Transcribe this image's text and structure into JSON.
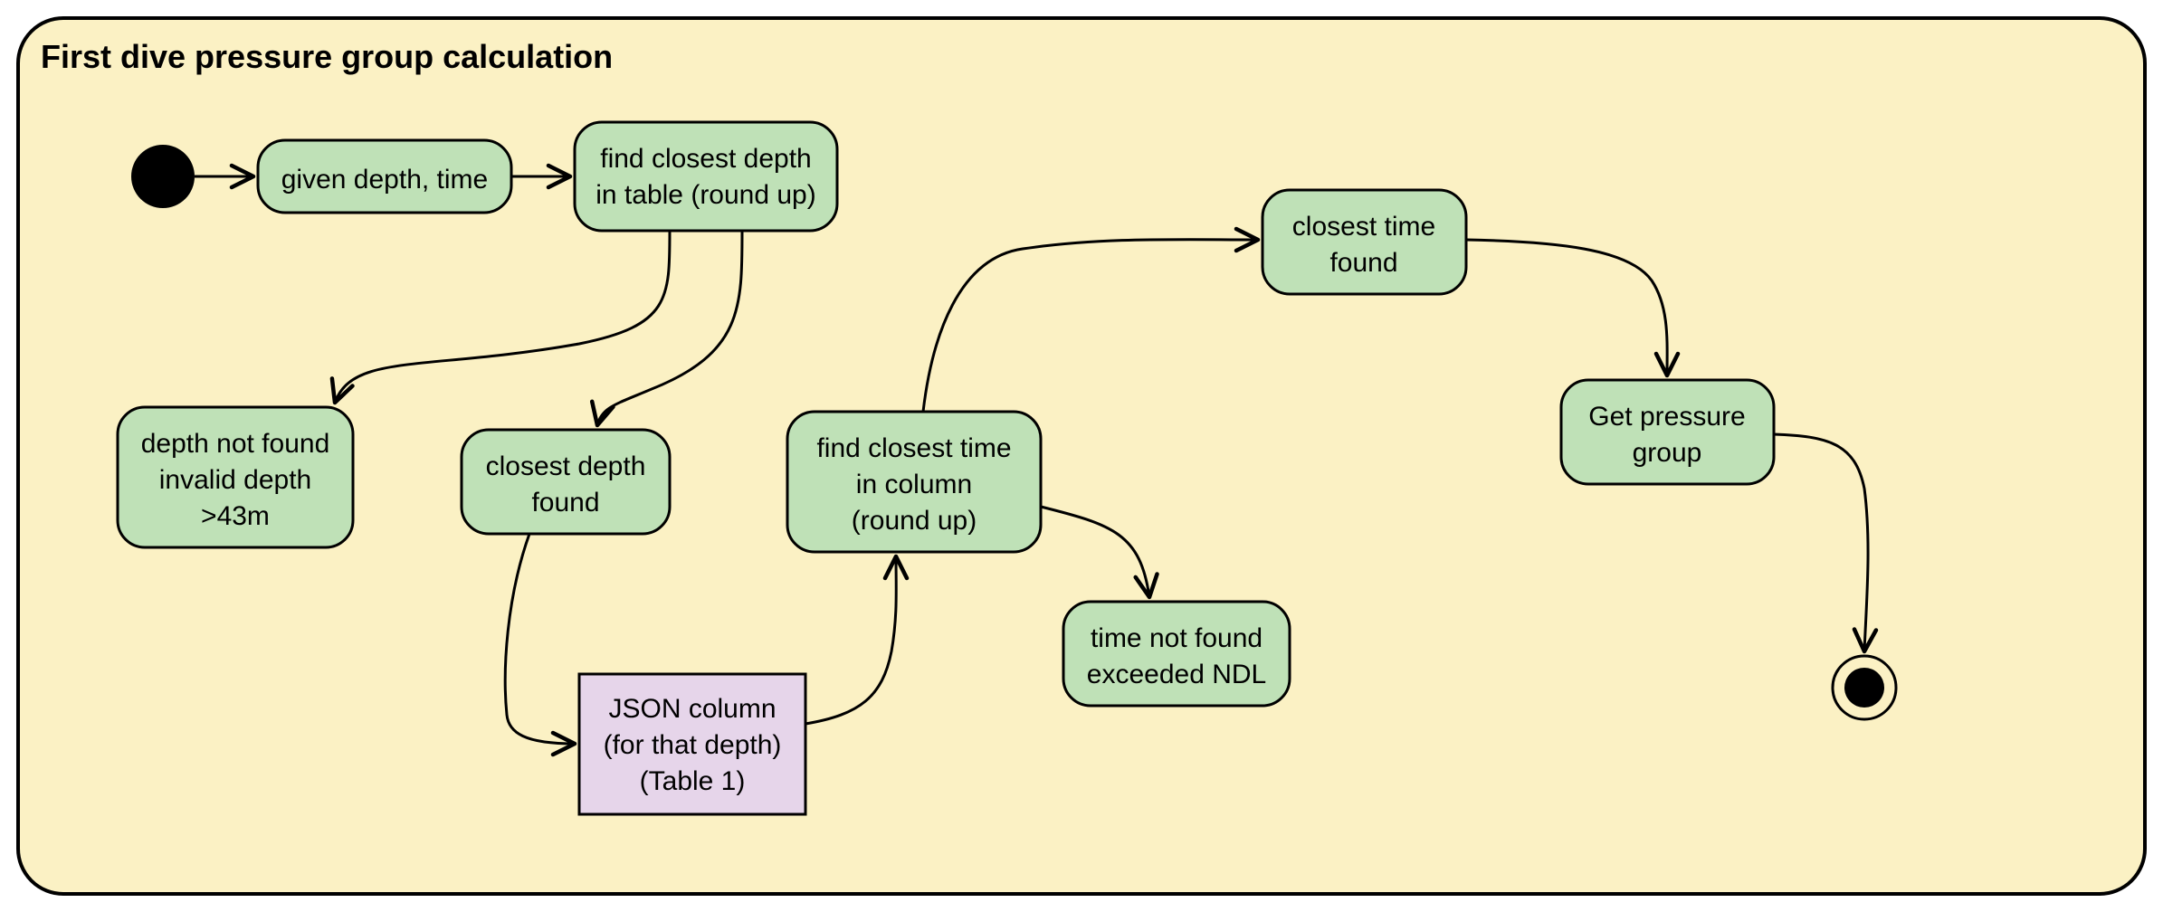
{
  "diagram": {
    "title": "First dive pressure group calculation",
    "nodes": {
      "given": "given depth, time",
      "findDepth1": "find closest depth",
      "findDepth2": "in table (round up)",
      "depthNotFound1": "depth not found",
      "depthNotFound2": "invalid depth",
      "depthNotFound3": ">43m",
      "closestDepth1": "closest depth",
      "closestDepth2": "found",
      "json1": "JSON column",
      "json2": "(for that depth)",
      "json3": "(Table 1)",
      "findTime1": "find closest time",
      "findTime2": "in column",
      "findTime3": "(round up)",
      "timeNotFound1": "time not found",
      "timeNotFound2": "exceeded NDL",
      "closestTime1": "closest time",
      "closestTime2": "found",
      "getPressure1": "Get pressure",
      "getPressure2": "group"
    }
  }
}
